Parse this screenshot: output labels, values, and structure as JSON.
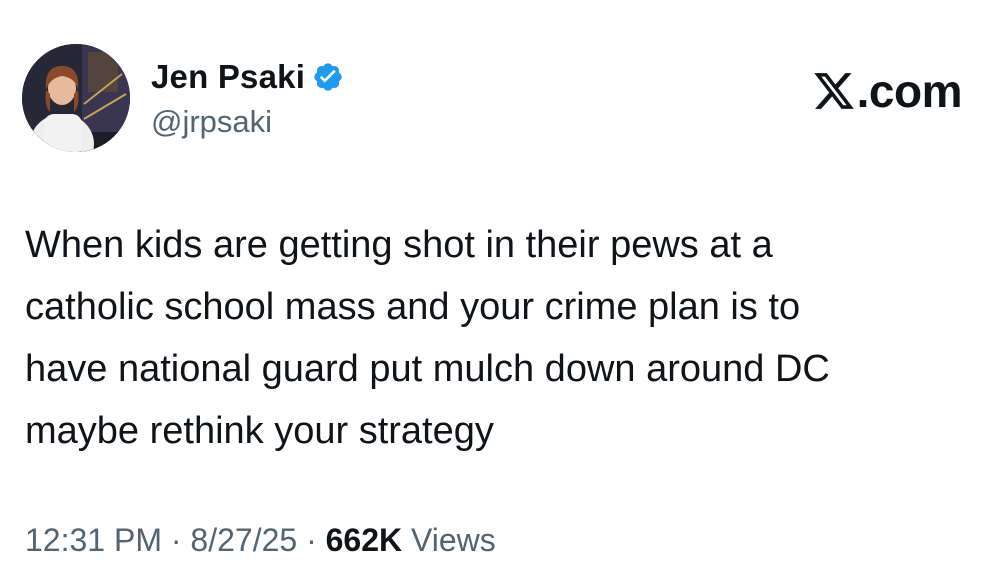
{
  "author": {
    "display_name": "Jen Psaki",
    "handle": "@jrpsaki",
    "verified": true,
    "verified_icon": "verified-badge-icon",
    "verified_color": "#1d9bf0"
  },
  "brand": {
    "icon": "x-logo-icon",
    "text": ".com"
  },
  "tweet": {
    "lines": [
      "When kids are getting shot in their pews at a",
      "catholic school mass and your crime plan is to",
      "have national guard put mulch down around DC",
      "maybe rethink your strategy"
    ]
  },
  "meta": {
    "time": "12:31 PM",
    "separator": " · ",
    "date": "8/27/25",
    "views_count": "662K",
    "views_label": "Views"
  },
  "colors": {
    "text_primary": "#0f1419",
    "text_secondary": "#536471",
    "background": "#ffffff"
  }
}
